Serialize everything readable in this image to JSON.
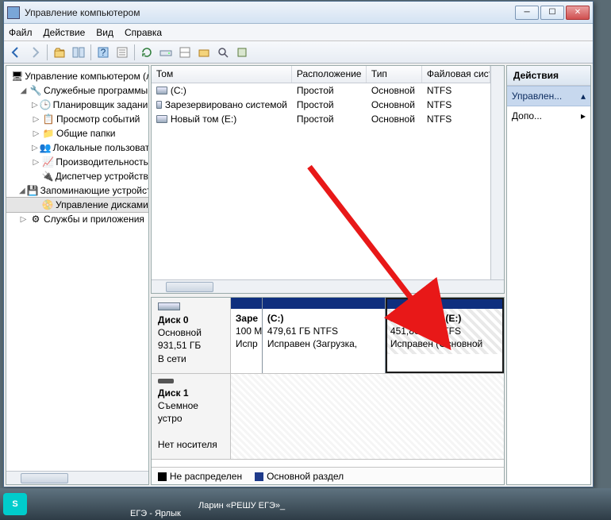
{
  "window": {
    "title": "Управление компьютером"
  },
  "menu": {
    "file": "Файл",
    "action": "Действие",
    "view": "Вид",
    "help": "Справка"
  },
  "tree": {
    "root": "Управление компьютером (л",
    "system_tools": "Служебные программы",
    "task_scheduler": "Планировщик заданий",
    "event_viewer": "Просмотр событий",
    "shared_folders": "Общие папки",
    "local_users": "Локальные пользоват",
    "performance": "Производительность",
    "device_manager": "Диспетчер устройств",
    "storage": "Запоминающие устройст",
    "disk_management": "Управление дисками",
    "services_apps": "Службы и приложения"
  },
  "vol_headers": {
    "vol": "Том",
    "layout": "Расположение",
    "type": "Тип",
    "fs": "Файловая сист"
  },
  "volumes": [
    {
      "name": "(C:)",
      "layout": "Простой",
      "type": "Основной",
      "fs": "NTFS"
    },
    {
      "name": "Зарезервировано системой",
      "layout": "Простой",
      "type": "Основной",
      "fs": "NTFS"
    },
    {
      "name": "Новый том (E:)",
      "layout": "Простой",
      "type": "Основной",
      "fs": "NTFS"
    }
  ],
  "disk0": {
    "title": "Диск 0",
    "type": "Основной",
    "size": "931,51 ГБ",
    "status": "В сети",
    "p0": {
      "l1": "Заре",
      "l2": "100 М",
      "l3": "Испр"
    },
    "p1": {
      "l1": "(C:)",
      "l2": "479,61 ГБ NTFS",
      "l3": "Исправен (Загрузка,"
    },
    "p2": {
      "l1": "Новый том  (E:)",
      "l2": "451,80 ГБ NTFS",
      "l3": "Исправен (Основной"
    }
  },
  "disk1": {
    "title": "Диск 1",
    "type": "Съемное устро",
    "status": "Нет носителя"
  },
  "legend": {
    "unalloc": "Не распределен",
    "primary": "Основной раздел"
  },
  "actions": {
    "header": "Действия",
    "item1": "Управлен...",
    "item2": "Допо..."
  },
  "taskbar": {
    "t1": "ЕГЭ - Ярлык",
    "t2": "Ларин «РЕШУ ЕГЭ»_"
  },
  "colors": {
    "partbar": "#0f2f7e",
    "unalloc": "#000000",
    "primary": "#1e3a8a"
  }
}
